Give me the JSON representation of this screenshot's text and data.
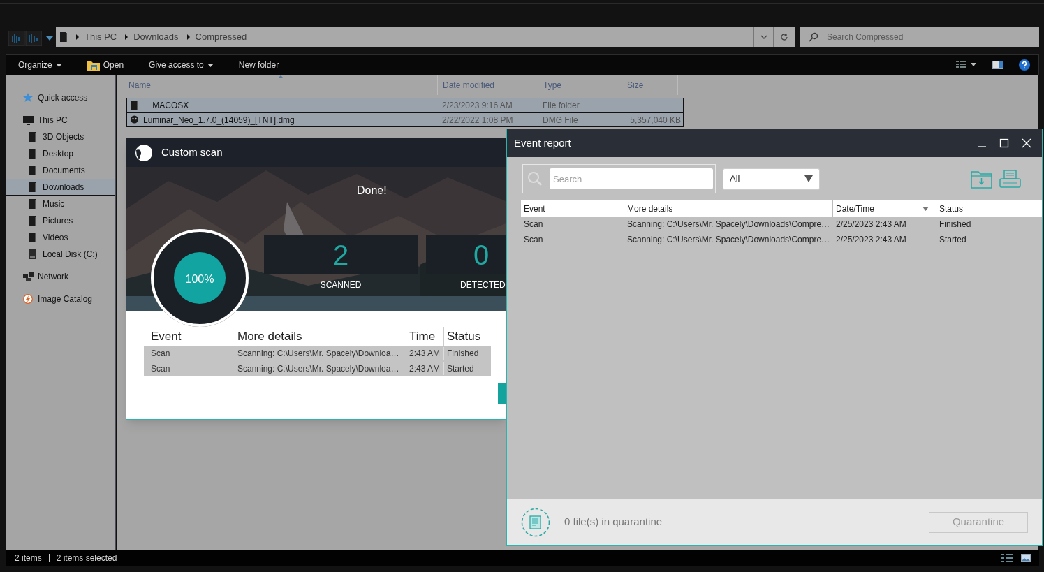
{
  "explorer": {
    "breadcrumb": [
      "This PC",
      "Downloads",
      "Compressed"
    ],
    "search": {
      "placeholder": "Search Compressed"
    },
    "toolbar": [
      {
        "label": "Organize",
        "kind": "menu"
      },
      {
        "label": "Open",
        "kind": "open"
      },
      {
        "label": "Give access to",
        "kind": "menu"
      },
      {
        "label": "New folder",
        "kind": "plain"
      }
    ],
    "sidebar": {
      "items": [
        {
          "label": "Quick access",
          "kind": "star",
          "selected": false
        },
        {
          "label": "This PC",
          "kind": "pc",
          "selected": false,
          "children": [
            {
              "label": "3D Objects",
              "kind": "folder",
              "selected": false
            },
            {
              "label": "Desktop",
              "kind": "folder",
              "selected": false
            },
            {
              "label": "Documents",
              "kind": "folder",
              "selected": false
            },
            {
              "label": "Downloads",
              "kind": "folder",
              "selected": true
            },
            {
              "label": "Music",
              "kind": "folder",
              "selected": false
            },
            {
              "label": "Pictures",
              "kind": "folder",
              "selected": false
            },
            {
              "label": "Videos",
              "kind": "folder",
              "selected": false
            },
            {
              "label": "Local Disk (C:)",
              "kind": "disk",
              "selected": false
            }
          ]
        },
        {
          "label": "Network",
          "kind": "network",
          "selected": false
        },
        {
          "label": "Image Catalog",
          "kind": "catalog",
          "selected": false
        }
      ]
    },
    "columns": [
      {
        "label": "Name",
        "sorted": true
      },
      {
        "label": "Date modified",
        "sorted": false
      },
      {
        "label": "Type",
        "sorted": false
      },
      {
        "label": "Size",
        "sorted": false
      }
    ],
    "rows": [
      {
        "kind": "folder",
        "selected": true,
        "cells": [
          "__MACOSX",
          "2/23/2023 9:16 AM",
          "File folder",
          null
        ]
      },
      {
        "kind": "dmg",
        "selected": true,
        "cells": [
          "Luminar_Neo_1.7.0_(14059)_[TNT].dmg",
          "2/22/2022 1:08 PM",
          "DMG File",
          "5,357,040 KB"
        ]
      }
    ],
    "status_bar": [
      "2 items",
      "2 items selected"
    ]
  },
  "custom_scan": {
    "title": "Custom scan",
    "status": "Done!",
    "progress": {
      "label": "100%",
      "level": 1
    },
    "stats": [
      {
        "value": "2",
        "label": "SCANNED"
      },
      {
        "value": "0",
        "label": "DETECTED"
      }
    ],
    "columns": [
      "Event",
      "More details",
      "Time",
      "Status"
    ],
    "rows": [
      [
        "Scan",
        "Scanning: C:\\Users\\Mr. Spacely\\Downloa…",
        "2:43 AM",
        "Finished"
      ],
      [
        "Scan",
        "Scanning: C:\\Users\\Mr. Spacely\\Downloa…",
        "2:43 AM",
        "Started"
      ]
    ]
  },
  "event_report": {
    "title": "Event report",
    "search": {
      "placeholder": "Search"
    },
    "filter": "All",
    "columns": [
      {
        "label": "Event",
        "sorted": false
      },
      {
        "label": "More details",
        "sorted": false
      },
      {
        "label": "Date/Time",
        "sorted": true
      },
      {
        "label": "Status",
        "sorted": false
      }
    ],
    "rows": [
      [
        "Scan",
        "Scanning: C:\\Users\\Mr. Spacely\\Downloads\\Compre…",
        "2/25/2023 2:43 AM",
        "Finished"
      ],
      [
        "Scan",
        "Scanning: C:\\Users\\Mr. Spacely\\Downloads\\Compre…",
        "2/25/2023 2:43 AM",
        "Started"
      ]
    ],
    "quarantine_text": "0 file(s) in quarantine",
    "quarantine_button": {
      "label": "Quarantine",
      "disabled": true
    }
  }
}
